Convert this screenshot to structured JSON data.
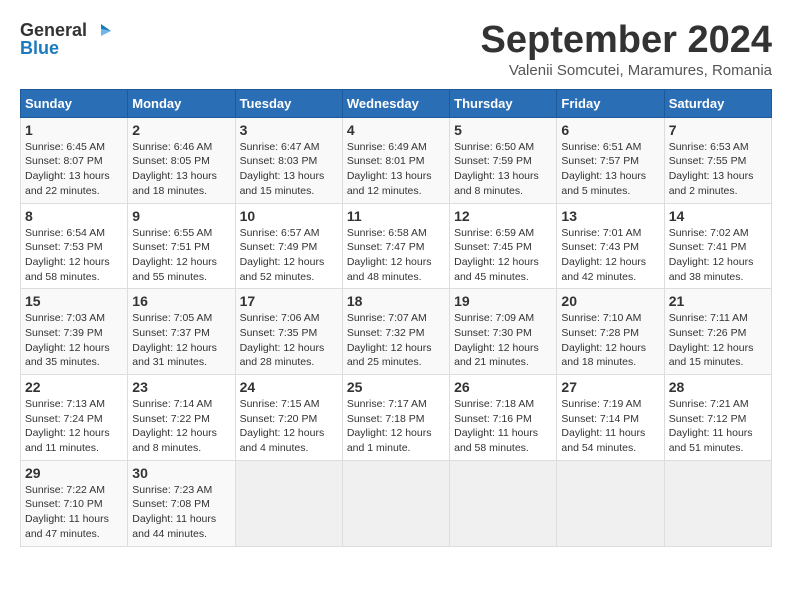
{
  "header": {
    "logo_line1": "General",
    "logo_line2": "Blue",
    "month": "September 2024",
    "location": "Valenii Somcutei, Maramures, Romania"
  },
  "days_of_week": [
    "Sunday",
    "Monday",
    "Tuesday",
    "Wednesday",
    "Thursday",
    "Friday",
    "Saturday"
  ],
  "weeks": [
    [
      {
        "day": "1",
        "info": "Sunrise: 6:45 AM\nSunset: 8:07 PM\nDaylight: 13 hours\nand 22 minutes."
      },
      {
        "day": "2",
        "info": "Sunrise: 6:46 AM\nSunset: 8:05 PM\nDaylight: 13 hours\nand 18 minutes."
      },
      {
        "day": "3",
        "info": "Sunrise: 6:47 AM\nSunset: 8:03 PM\nDaylight: 13 hours\nand 15 minutes."
      },
      {
        "day": "4",
        "info": "Sunrise: 6:49 AM\nSunset: 8:01 PM\nDaylight: 13 hours\nand 12 minutes."
      },
      {
        "day": "5",
        "info": "Sunrise: 6:50 AM\nSunset: 7:59 PM\nDaylight: 13 hours\nand 8 minutes."
      },
      {
        "day": "6",
        "info": "Sunrise: 6:51 AM\nSunset: 7:57 PM\nDaylight: 13 hours\nand 5 minutes."
      },
      {
        "day": "7",
        "info": "Sunrise: 6:53 AM\nSunset: 7:55 PM\nDaylight: 13 hours\nand 2 minutes."
      }
    ],
    [
      {
        "day": "8",
        "info": "Sunrise: 6:54 AM\nSunset: 7:53 PM\nDaylight: 12 hours\nand 58 minutes."
      },
      {
        "day": "9",
        "info": "Sunrise: 6:55 AM\nSunset: 7:51 PM\nDaylight: 12 hours\nand 55 minutes."
      },
      {
        "day": "10",
        "info": "Sunrise: 6:57 AM\nSunset: 7:49 PM\nDaylight: 12 hours\nand 52 minutes."
      },
      {
        "day": "11",
        "info": "Sunrise: 6:58 AM\nSunset: 7:47 PM\nDaylight: 12 hours\nand 48 minutes."
      },
      {
        "day": "12",
        "info": "Sunrise: 6:59 AM\nSunset: 7:45 PM\nDaylight: 12 hours\nand 45 minutes."
      },
      {
        "day": "13",
        "info": "Sunrise: 7:01 AM\nSunset: 7:43 PM\nDaylight: 12 hours\nand 42 minutes."
      },
      {
        "day": "14",
        "info": "Sunrise: 7:02 AM\nSunset: 7:41 PM\nDaylight: 12 hours\nand 38 minutes."
      }
    ],
    [
      {
        "day": "15",
        "info": "Sunrise: 7:03 AM\nSunset: 7:39 PM\nDaylight: 12 hours\nand 35 minutes."
      },
      {
        "day": "16",
        "info": "Sunrise: 7:05 AM\nSunset: 7:37 PM\nDaylight: 12 hours\nand 31 minutes."
      },
      {
        "day": "17",
        "info": "Sunrise: 7:06 AM\nSunset: 7:35 PM\nDaylight: 12 hours\nand 28 minutes."
      },
      {
        "day": "18",
        "info": "Sunrise: 7:07 AM\nSunset: 7:32 PM\nDaylight: 12 hours\nand 25 minutes."
      },
      {
        "day": "19",
        "info": "Sunrise: 7:09 AM\nSunset: 7:30 PM\nDaylight: 12 hours\nand 21 minutes."
      },
      {
        "day": "20",
        "info": "Sunrise: 7:10 AM\nSunset: 7:28 PM\nDaylight: 12 hours\nand 18 minutes."
      },
      {
        "day": "21",
        "info": "Sunrise: 7:11 AM\nSunset: 7:26 PM\nDaylight: 12 hours\nand 15 minutes."
      }
    ],
    [
      {
        "day": "22",
        "info": "Sunrise: 7:13 AM\nSunset: 7:24 PM\nDaylight: 12 hours\nand 11 minutes."
      },
      {
        "day": "23",
        "info": "Sunrise: 7:14 AM\nSunset: 7:22 PM\nDaylight: 12 hours\nand 8 minutes."
      },
      {
        "day": "24",
        "info": "Sunrise: 7:15 AM\nSunset: 7:20 PM\nDaylight: 12 hours\nand 4 minutes."
      },
      {
        "day": "25",
        "info": "Sunrise: 7:17 AM\nSunset: 7:18 PM\nDaylight: 12 hours\nand 1 minute."
      },
      {
        "day": "26",
        "info": "Sunrise: 7:18 AM\nSunset: 7:16 PM\nDaylight: 11 hours\nand 58 minutes."
      },
      {
        "day": "27",
        "info": "Sunrise: 7:19 AM\nSunset: 7:14 PM\nDaylight: 11 hours\nand 54 minutes."
      },
      {
        "day": "28",
        "info": "Sunrise: 7:21 AM\nSunset: 7:12 PM\nDaylight: 11 hours\nand 51 minutes."
      }
    ],
    [
      {
        "day": "29",
        "info": "Sunrise: 7:22 AM\nSunset: 7:10 PM\nDaylight: 11 hours\nand 47 minutes."
      },
      {
        "day": "30",
        "info": "Sunrise: 7:23 AM\nSunset: 7:08 PM\nDaylight: 11 hours\nand 44 minutes."
      },
      {
        "day": "",
        "info": ""
      },
      {
        "day": "",
        "info": ""
      },
      {
        "day": "",
        "info": ""
      },
      {
        "day": "",
        "info": ""
      },
      {
        "day": "",
        "info": ""
      }
    ]
  ]
}
